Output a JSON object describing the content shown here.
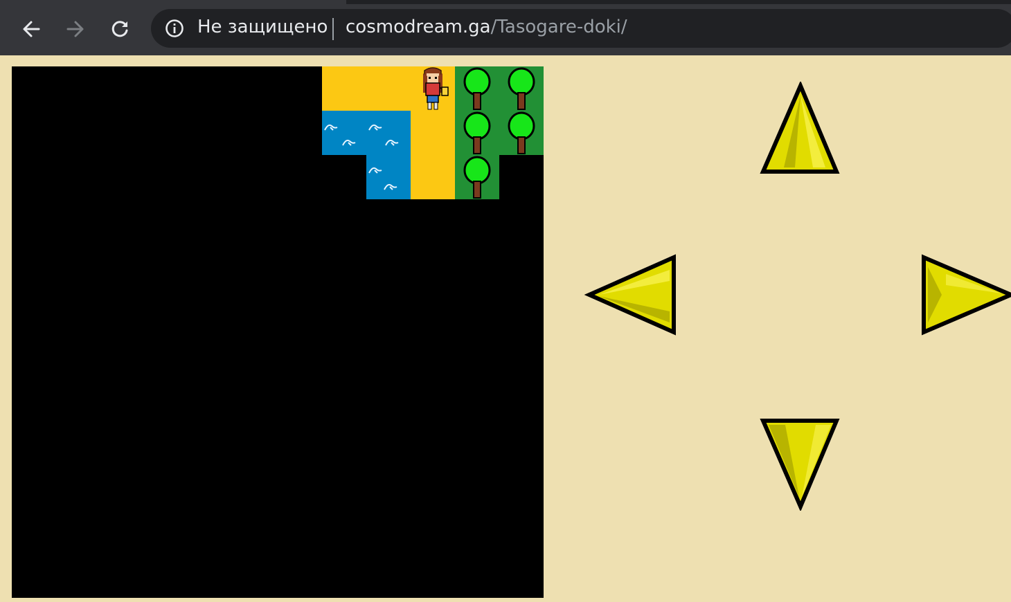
{
  "browser": {
    "security_label": "Не защищено",
    "url_host": "cosmodream.ga",
    "url_path": "/Tasogare-doki/",
    "nav_icons": [
      "back-arrow-icon",
      "forward-arrow-icon",
      "reload-icon",
      "info-icon"
    ]
  },
  "colors": {
    "page_background": "#eee0b1",
    "sand": "#fcc813",
    "water": "#0085c4",
    "grass": "#229035",
    "arrow_fill": "#e1dc00",
    "arrow_outline": "#000000"
  },
  "controls": {
    "arrows": [
      "up",
      "left",
      "right",
      "down"
    ]
  }
}
